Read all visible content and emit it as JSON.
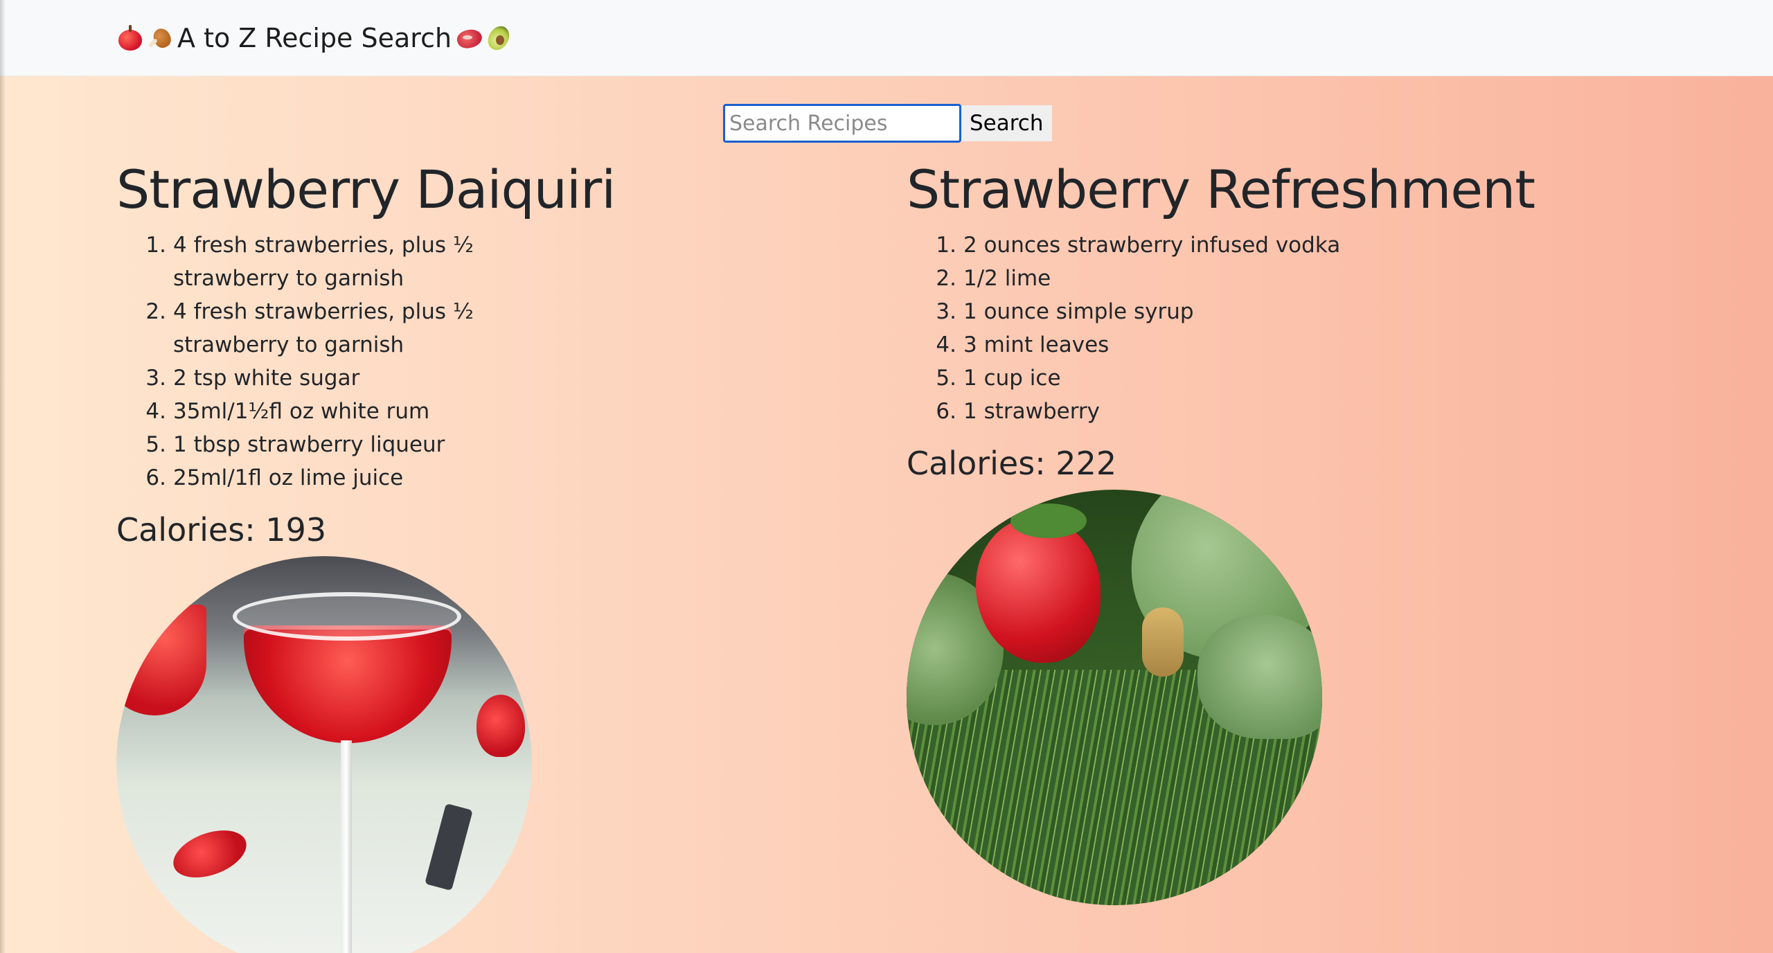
{
  "navbar": {
    "brand_title": "A to Z Recipe Search",
    "brand_icons_left": [
      "apple-icon",
      "drumstick-icon"
    ],
    "brand_icons_right": [
      "meat-icon",
      "avocado-icon"
    ]
  },
  "search": {
    "placeholder": "Search Recipes",
    "value": "",
    "button_label": "Search"
  },
  "recipes": [
    {
      "title": "Strawberry Daiquiri",
      "ingredients": [
        "4 fresh strawberries, plus ½ strawberry to garnish",
        "4 fresh strawberries, plus ½ strawberry to garnish",
        "2 tsp white sugar",
        "35ml/1½fl oz white rum",
        "1 tbsp strawberry liqueur",
        "25ml/1fl oz lime juice"
      ],
      "calories_label": "Calories: 193"
    },
    {
      "title": "Strawberry Refreshment",
      "ingredients": [
        "2 ounces strawberry infused vodka",
        "1/2 lime",
        "1 ounce simple syrup",
        "3 mint leaves",
        "1 cup ice",
        "1 strawberry"
      ],
      "calories_label": "Calories: 222"
    }
  ],
  "colors": {
    "navbar_bg": "#f8f9fa",
    "gradient_start": "#ffe7cf",
    "gradient_end": "#f9b29c",
    "input_focus_border": "#1a5fd0"
  }
}
